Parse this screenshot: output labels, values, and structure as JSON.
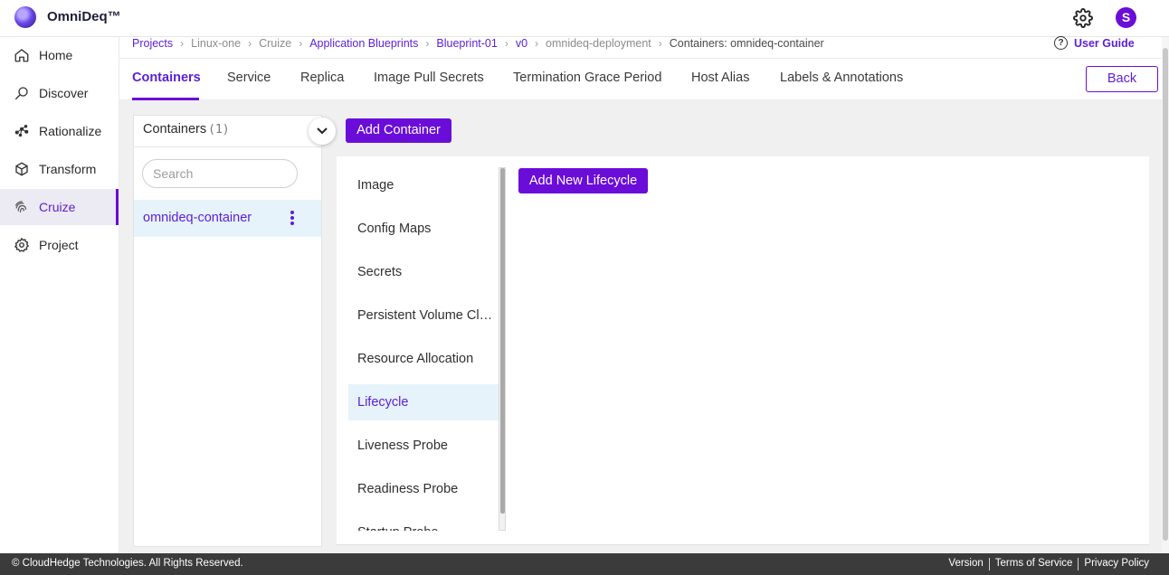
{
  "app": {
    "brand": "OmniDeq™",
    "avatar_initial": "S"
  },
  "colors": {
    "accent": "#6a0dd9",
    "active_bg": "#e6f3fb",
    "footer_bg": "#3b3b3b"
  },
  "sidebar": {
    "items": [
      {
        "label": "Home",
        "icon": "home-icon"
      },
      {
        "label": "Discover",
        "icon": "search-icon"
      },
      {
        "label": "Rationalize",
        "icon": "network-icon"
      },
      {
        "label": "Transform",
        "icon": "cube-icon"
      },
      {
        "label": "Cruize",
        "icon": "fingerprint-icon",
        "active": true
      },
      {
        "label": "Project",
        "icon": "gear-icon"
      }
    ]
  },
  "breadcrumb": {
    "items": [
      "Projects",
      "Linux-one",
      "Cruize",
      "Application Blueprints",
      "Blueprint-01",
      "v0",
      "omnideq-deployment",
      "Containers: omnideq-container"
    ]
  },
  "header": {
    "user_guide": "User Guide",
    "help_icon": "?"
  },
  "tabs": {
    "items": [
      "Containers",
      "Service",
      "Replica",
      "Image Pull Secrets",
      "Termination Grace Period",
      "Host Alias",
      "Labels & Annotations"
    ],
    "active": "Containers",
    "back_label": "Back"
  },
  "containers_panel": {
    "title": "Containers",
    "count": "(1)",
    "search_placeholder": "Search",
    "items": [
      "omnideq-container"
    ],
    "add_button": "Add Container"
  },
  "container_sections": {
    "items": [
      "Image",
      "Config Maps",
      "Secrets",
      "Persistent Volume Claims",
      "Resource Allocation",
      "Lifecycle",
      "Liveness Probe",
      "Readiness Probe",
      "Startup Probe"
    ],
    "active": "Lifecycle"
  },
  "lifecycle": {
    "add_button": "Add New Lifecycle"
  },
  "footer": {
    "copyright": "© CloudHedge Technologies. All Rights Reserved.",
    "links": [
      "Version",
      "Terms of Service",
      "Privacy Policy"
    ]
  }
}
